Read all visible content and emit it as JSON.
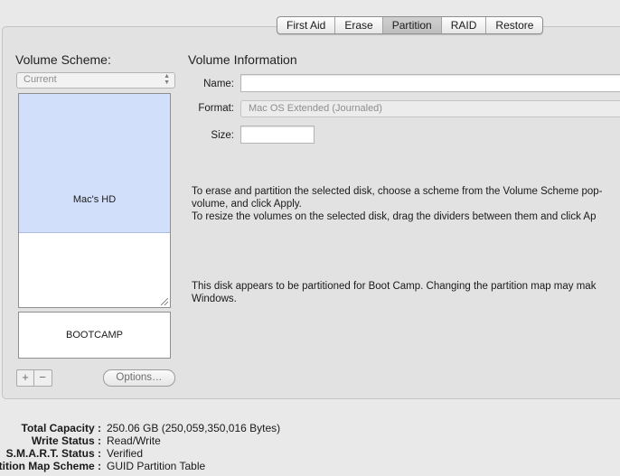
{
  "tabs": [
    {
      "label": "First Aid",
      "active": false
    },
    {
      "label": "Erase",
      "active": false
    },
    {
      "label": "Partition",
      "active": true
    },
    {
      "label": "RAID",
      "active": false
    },
    {
      "label": "Restore",
      "active": false
    }
  ],
  "left": {
    "heading": "Volume Scheme:",
    "scheme_popup_value": "Current",
    "volumes": [
      "Mac's HD",
      "BOOTCAMP"
    ],
    "add_label": "+",
    "remove_label": "−",
    "options_label": "Options…"
  },
  "right": {
    "heading": "Volume Information",
    "name_label": "Name:",
    "name_value": "",
    "format_label": "Format:",
    "format_value": "Mac OS Extended (Journaled)",
    "size_label": "Size:",
    "size_value": "",
    "instructions": [
      "To erase and partition the selected disk, choose a scheme from the Volume Scheme pop-",
      "volume, and click Apply.",
      "To resize the volumes on the selected disk, drag the dividers between them and click Ap"
    ],
    "bootcamp_note": [
      "This disk appears to be partitioned for Boot Camp. Changing the partition map may mak",
      "Windows."
    ]
  },
  "disk_info": [
    {
      "key": "Total Capacity :",
      "value": "250.06 GB (250,059,350,016 Bytes)"
    },
    {
      "key": "Write Status :",
      "value": "Read/Write"
    },
    {
      "key": "S.M.A.R.T. Status :",
      "value": "Verified"
    },
    {
      "key": "rtition Map Scheme :",
      "value": "GUID Partition Table"
    }
  ],
  "colors": {
    "selected_volume": "#d2dffa",
    "panel": "#e2e2e2",
    "window": "#e9e9e9"
  }
}
